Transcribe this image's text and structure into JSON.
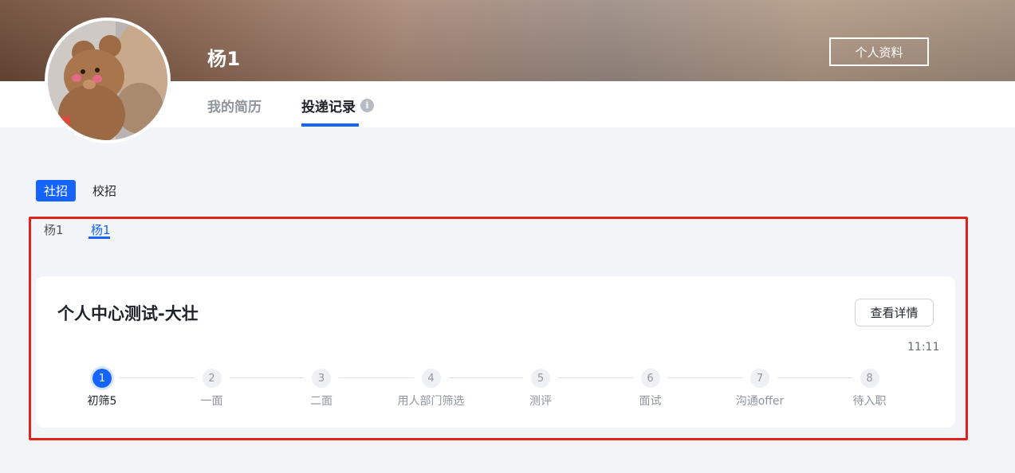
{
  "header": {
    "user_name": "杨1",
    "profile_button": "个人资料"
  },
  "tabs": [
    {
      "label": "我的简历",
      "active": false
    },
    {
      "label": "投递记录",
      "active": true
    }
  ],
  "recruit_types": [
    {
      "label": "社招",
      "active": true
    },
    {
      "label": "校招",
      "active": false
    }
  ],
  "sub_tabs": [
    {
      "label": "杨1",
      "active": false
    },
    {
      "label": "杨1",
      "active": true
    }
  ],
  "application": {
    "title": "个人中心测试-大壮",
    "detail_button": "查看详情",
    "time": "11:11",
    "current_step": 1,
    "steps": [
      {
        "number": "1",
        "label": "初筛5"
      },
      {
        "number": "2",
        "label": "一面"
      },
      {
        "number": "3",
        "label": "二面"
      },
      {
        "number": "4",
        "label": "用人部门筛选"
      },
      {
        "number": "5",
        "label": "测评"
      },
      {
        "number": "6",
        "label": "面试"
      },
      {
        "number": "7",
        "label": "沟通offer"
      },
      {
        "number": "8",
        "label": "待入职"
      }
    ]
  },
  "colors": {
    "accent": "#1664ff",
    "highlight_border": "#e0231c",
    "page_background": "#f3f4f7"
  },
  "icons": {
    "info": "info-icon",
    "avatar": "teddy-bear-avatar"
  }
}
